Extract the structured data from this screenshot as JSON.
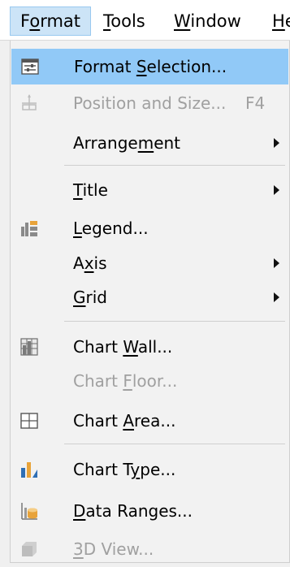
{
  "menubar": {
    "format": "Format",
    "tools": "Tools",
    "window": "Window",
    "help_partial": "He"
  },
  "menu": {
    "items": [
      {
        "label": "Format Selection...",
        "underline_char": "S",
        "icon": "format-selection-icon",
        "enabled": true,
        "highlighted": true,
        "submenu": false
      },
      {
        "label": "Position and Size...",
        "shortcut": "F4",
        "icon": "position-size-icon",
        "enabled": false,
        "submenu": false
      },
      {
        "label": "Arrangement",
        "underline_char": "m",
        "enabled": true,
        "submenu": true
      },
      {
        "label": "Title",
        "underline_char": "T",
        "enabled": true,
        "submenu": true
      },
      {
        "label": "Legend...",
        "underline_char": "L",
        "icon": "legend-icon",
        "enabled": true,
        "submenu": false
      },
      {
        "label": "Axis",
        "underline_char": "x",
        "enabled": true,
        "submenu": true
      },
      {
        "label": "Grid",
        "underline_char": "G",
        "enabled": true,
        "submenu": true
      },
      {
        "label": "Chart Wall...",
        "underline_char": "W",
        "icon": "chart-wall-icon",
        "enabled": true,
        "submenu": false
      },
      {
        "label": "Chart Floor...",
        "underline_char": "F",
        "enabled": false,
        "submenu": false
      },
      {
        "label": "Chart Area...",
        "underline_char": "A",
        "icon": "chart-area-icon",
        "enabled": true,
        "submenu": false
      },
      {
        "label": "Chart Type...",
        "underline_char": "y",
        "icon": "chart-type-icon",
        "enabled": true,
        "submenu": false
      },
      {
        "label": "Data Ranges...",
        "underline_char": "D",
        "icon": "data-ranges-icon",
        "enabled": true,
        "submenu": false
      },
      {
        "label": "3D View...",
        "underline_char": "3",
        "icon": "3d-view-icon",
        "enabled": false,
        "submenu": false
      }
    ]
  },
  "colors": {
    "highlight": "#91c9f7",
    "menubar_active": "#cce4f7",
    "disabled_text": "#a0a0a0",
    "icon_blue": "#2f6fb5",
    "icon_orange": "#e8a33a"
  }
}
